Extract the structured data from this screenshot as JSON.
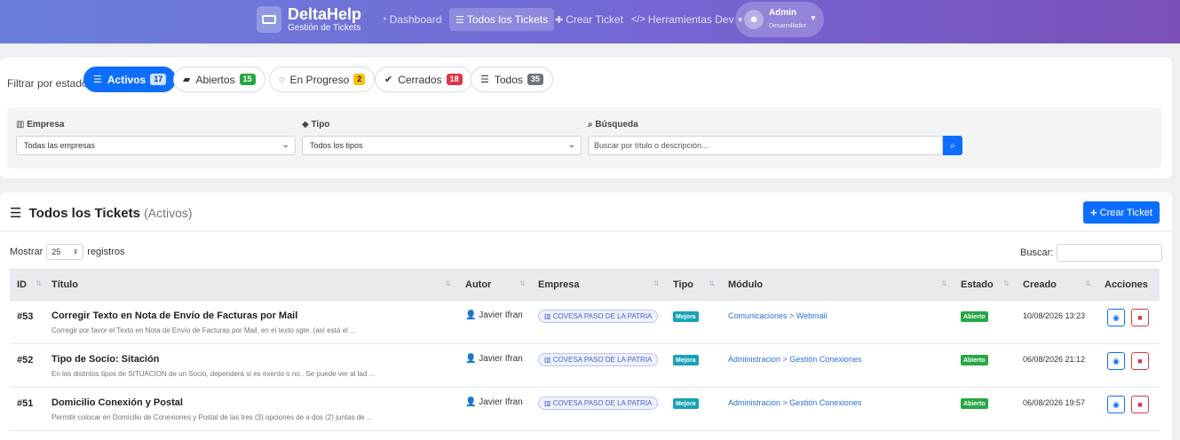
{
  "header": {
    "brand_title": "DeltaHelp",
    "brand_subtitle": "Gestión de Tickets",
    "nav": [
      {
        "label": "Dashboard",
        "icon": "dashboard-icon"
      },
      {
        "label": "Todos los Tickets",
        "icon": "list-icon",
        "active": true
      },
      {
        "label": "Crear Ticket",
        "icon": "plus-icon"
      },
      {
        "label": "Herramientas Dev",
        "icon": "code-icon"
      }
    ],
    "user": {
      "name": "Admin",
      "role": "Desarrollador"
    }
  },
  "filters": {
    "label": "Filtrar por estado:",
    "chips": [
      {
        "label": "Activos",
        "count": "17",
        "active": true
      },
      {
        "label": "Abiertos",
        "count": "15"
      },
      {
        "label": "En Progreso",
        "count": "2"
      },
      {
        "label": "Cerrados",
        "count": "18"
      },
      {
        "label": "Todos",
        "count": "35"
      }
    ],
    "empresa_label": "Empresa",
    "empresa_value": "Todas las empresas",
    "tipo_label": "Tipo",
    "tipo_value": "Todos los tipos",
    "busqueda_label": "Búsqueda",
    "busqueda_placeholder": "Buscar por título o descripción..."
  },
  "tickets": {
    "title": "Todos los Tickets",
    "subtitle": "(Activos)",
    "create_label": "Crear Ticket",
    "show_label": "Mostrar",
    "page_length": "25",
    "records_label": "registros",
    "search_label": "Buscar:",
    "columns": {
      "id": "ID",
      "titulo": "Título",
      "autor": "Autor",
      "empresa": "Empresa",
      "tipo": "Tipo",
      "modulo": "Módulo",
      "estado": "Estado",
      "creado": "Creado",
      "acciones": "Acciones"
    },
    "rows": [
      {
        "id": "#53",
        "title": "Corregir Texto en Nota de Envío de Facturas por Mail",
        "desc": "Corregir por favor el Texto en Nota de Envío de Facturas por Mail, en el texto sgte. (así está el ...",
        "author": "Javier Ifran",
        "empresa": "COVESA PASO DE LA PATRIA",
        "tipo": "Mejora",
        "modulo": "Comunicaciones > Webmail",
        "estado": "Abierto",
        "fecha": "10/08/2026 13:23"
      },
      {
        "id": "#52",
        "title": "Tipo de Socio: Sitación",
        "desc": "En los distintos tipos de SITUACION de un Socio, dependerá si es exento o no.. Se puede ver al lad ...",
        "author": "Javier Ifran",
        "empresa": "COVESA PASO DE LA PATRIA",
        "tipo": "Mejora",
        "modulo": "Administracion > Gestión Conexiones",
        "estado": "Abierto",
        "fecha": "06/08/2026 21:12"
      },
      {
        "id": "#51",
        "title": "Domicilio Conexión y Postal",
        "desc": "Permitir colocar en Domicilio de Conexiones y Postal de las tres (3) opciones de a dos (2) juntas de ...",
        "author": "Javier Ifran",
        "empresa": "COVESA PASO DE LA PATRIA",
        "tipo": "Mejora",
        "modulo": "Administracion > Gestión Conexiones",
        "estado": "Abierto",
        "fecha": "06/08/2026 19:57"
      }
    ]
  }
}
